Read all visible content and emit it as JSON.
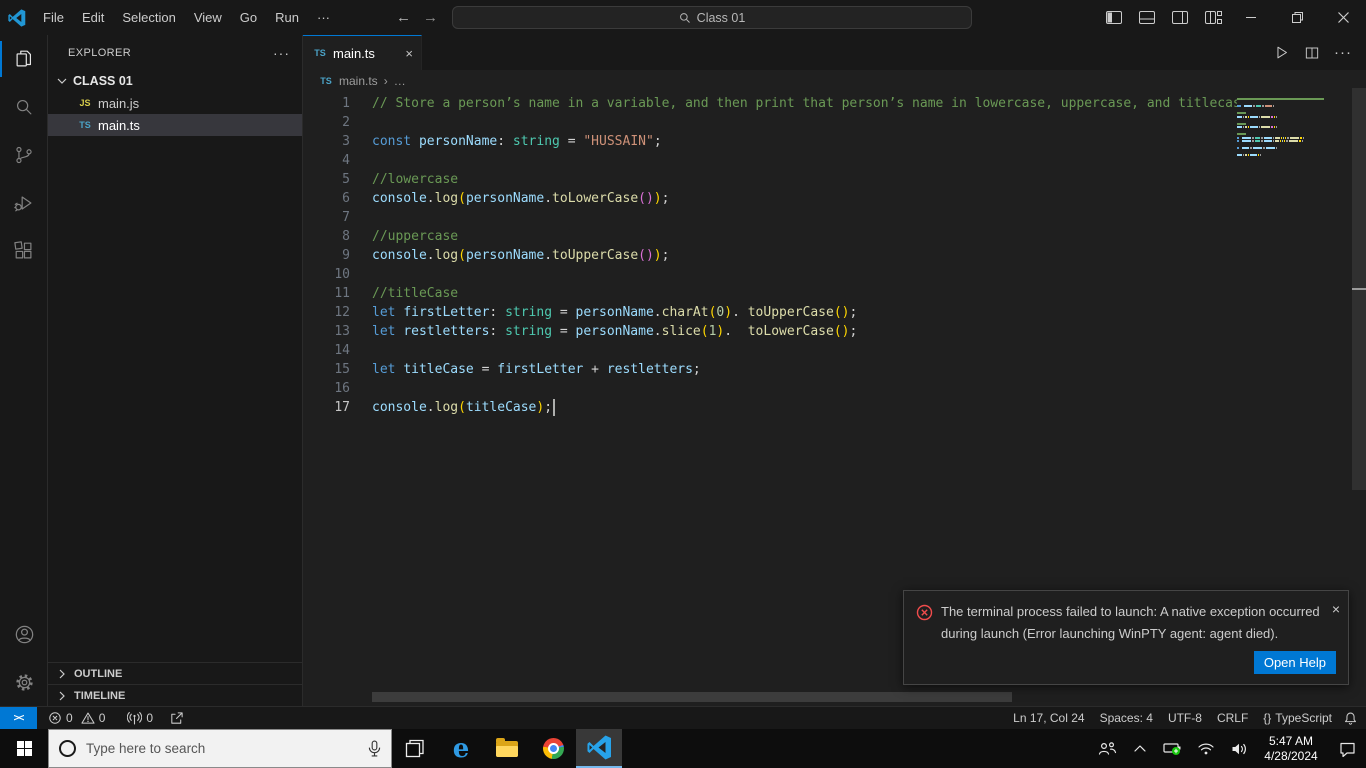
{
  "window": {
    "search_title": "Class 01"
  },
  "icons": {
    "close": "×",
    "more": "···",
    "ellipsis": "…",
    "breadcrumb_sep": "›"
  },
  "titlebar": {
    "menus": [
      "File",
      "Edit",
      "Selection",
      "View",
      "Go",
      "Run",
      "···"
    ],
    "nav_back": "←",
    "nav_forward": "→"
  },
  "sidebar": {
    "header": "EXPLORER",
    "more": "···",
    "folder": "CLASS 01",
    "files": [
      {
        "badge": "JS",
        "name": "main.js",
        "selected": false
      },
      {
        "badge": "TS",
        "name": "main.ts",
        "selected": true
      }
    ],
    "sections": [
      "OUTLINE",
      "TIMELINE"
    ]
  },
  "editor": {
    "tab": {
      "badge": "TS",
      "label": "main.ts"
    },
    "breadcrumb": {
      "badge": "TS",
      "file": "main.ts"
    },
    "lines": [
      {
        "n": 1,
        "t": [
          [
            "cm",
            "// Store a person’s name in a variable, and then print that person’s name in lowercase, uppercase, and titlecase"
          ]
        ]
      },
      {
        "n": 2,
        "t": []
      },
      {
        "n": 3,
        "t": [
          [
            "kw",
            "const"
          ],
          [
            "pl",
            " "
          ],
          [
            "vr",
            "personName"
          ],
          [
            "pl",
            ": "
          ],
          [
            "ty",
            "string"
          ],
          [
            "pl",
            " = "
          ],
          [
            "st",
            "\"HUSSAIN\""
          ],
          [
            "pl",
            ";"
          ]
        ]
      },
      {
        "n": 4,
        "t": []
      },
      {
        "n": 5,
        "t": [
          [
            "cm",
            "//lowercase"
          ]
        ]
      },
      {
        "n": 6,
        "t": [
          [
            "vr",
            "console"
          ],
          [
            "pl",
            "."
          ],
          [
            "fn",
            "log"
          ],
          [
            "b1",
            "("
          ],
          [
            "vr",
            "personName"
          ],
          [
            "pl",
            "."
          ],
          [
            "fn",
            "toLowerCase"
          ],
          [
            "b2",
            "()"
          ],
          [
            "b1",
            ")"
          ],
          [
            "pl",
            ";"
          ]
        ]
      },
      {
        "n": 7,
        "t": []
      },
      {
        "n": 8,
        "t": [
          [
            "cm",
            "//uppercase"
          ]
        ]
      },
      {
        "n": 9,
        "t": [
          [
            "vr",
            "console"
          ],
          [
            "pl",
            "."
          ],
          [
            "fn",
            "log"
          ],
          [
            "b1",
            "("
          ],
          [
            "vr",
            "personName"
          ],
          [
            "pl",
            "."
          ],
          [
            "fn",
            "toUpperCase"
          ],
          [
            "b2",
            "()"
          ],
          [
            "b1",
            ")"
          ],
          [
            "pl",
            ";"
          ]
        ]
      },
      {
        "n": 10,
        "t": []
      },
      {
        "n": 11,
        "t": [
          [
            "cm",
            "//titleCase"
          ]
        ]
      },
      {
        "n": 12,
        "t": [
          [
            "kw",
            "let"
          ],
          [
            "pl",
            " "
          ],
          [
            "vr",
            "firstLetter"
          ],
          [
            "pl",
            ": "
          ],
          [
            "ty",
            "string"
          ],
          [
            "pl",
            " = "
          ],
          [
            "vr",
            "personName"
          ],
          [
            "pl",
            "."
          ],
          [
            "fn",
            "charAt"
          ],
          [
            "b1",
            "("
          ],
          [
            "nu",
            "0"
          ],
          [
            "b1",
            ")"
          ],
          [
            "pl",
            ". "
          ],
          [
            "fn",
            "toUpperCase"
          ],
          [
            "b1",
            "()"
          ],
          [
            "pl",
            ";"
          ]
        ]
      },
      {
        "n": 13,
        "t": [
          [
            "kw",
            "let"
          ],
          [
            "pl",
            " "
          ],
          [
            "vr",
            "restletters"
          ],
          [
            "pl",
            ": "
          ],
          [
            "ty",
            "string"
          ],
          [
            "pl",
            " = "
          ],
          [
            "vr",
            "personName"
          ],
          [
            "pl",
            "."
          ],
          [
            "fn",
            "slice"
          ],
          [
            "b1",
            "("
          ],
          [
            "nu",
            "1"
          ],
          [
            "b1",
            ")"
          ],
          [
            "pl",
            ".  "
          ],
          [
            "fn",
            "toLowerCase"
          ],
          [
            "b1",
            "()"
          ],
          [
            "pl",
            ";"
          ]
        ]
      },
      {
        "n": 14,
        "t": []
      },
      {
        "n": 15,
        "t": [
          [
            "kw",
            "let"
          ],
          [
            "pl",
            " "
          ],
          [
            "vr",
            "titleCase"
          ],
          [
            "pl",
            " = "
          ],
          [
            "vr",
            "firstLetter"
          ],
          [
            "pl",
            " + "
          ],
          [
            "vr",
            "restletters"
          ],
          [
            "pl",
            ";"
          ]
        ]
      },
      {
        "n": 16,
        "t": []
      },
      {
        "n": 17,
        "t": [
          [
            "vr",
            "console"
          ],
          [
            "pl",
            "."
          ],
          [
            "fn",
            "log"
          ],
          [
            "b1",
            "("
          ],
          [
            "vr",
            "titleCase"
          ],
          [
            "b1",
            ")"
          ],
          [
            "pl",
            ";"
          ]
        ],
        "cursor": true
      }
    ]
  },
  "notification": {
    "message": "The terminal process failed to launch: A native exception occurred during launch (Error launching WinPTY agent: agent died).",
    "button": "Open Help"
  },
  "statusbar": {
    "remote": "><",
    "errors": "0",
    "warnings": "0",
    "ports": "0",
    "cursor_position": "Ln 17, Col 24",
    "indentation": "Spaces: 4",
    "encoding": "UTF-8",
    "eol": "CRLF",
    "language_icon": "{}",
    "language": "TypeScript"
  },
  "taskbar": {
    "search_placeholder": "Type here to search",
    "clock": {
      "time": "5:47 AM",
      "date": "4/28/2024"
    }
  },
  "colors": {
    "accent": "#0078d4",
    "error": "#f14c4c",
    "shell_bg": "#181818",
    "editor_bg": "#1f1f1f",
    "selection_bg": "#37373d",
    "comment": "#6a9955",
    "keyword": "#569cd6",
    "type": "#4ec9b0",
    "variable": "#9cdcfe",
    "function": "#dcdcaa",
    "string": "#ce9178",
    "number": "#b5cea8",
    "bracket1": "#ffd700",
    "bracket2": "#da70d6"
  }
}
